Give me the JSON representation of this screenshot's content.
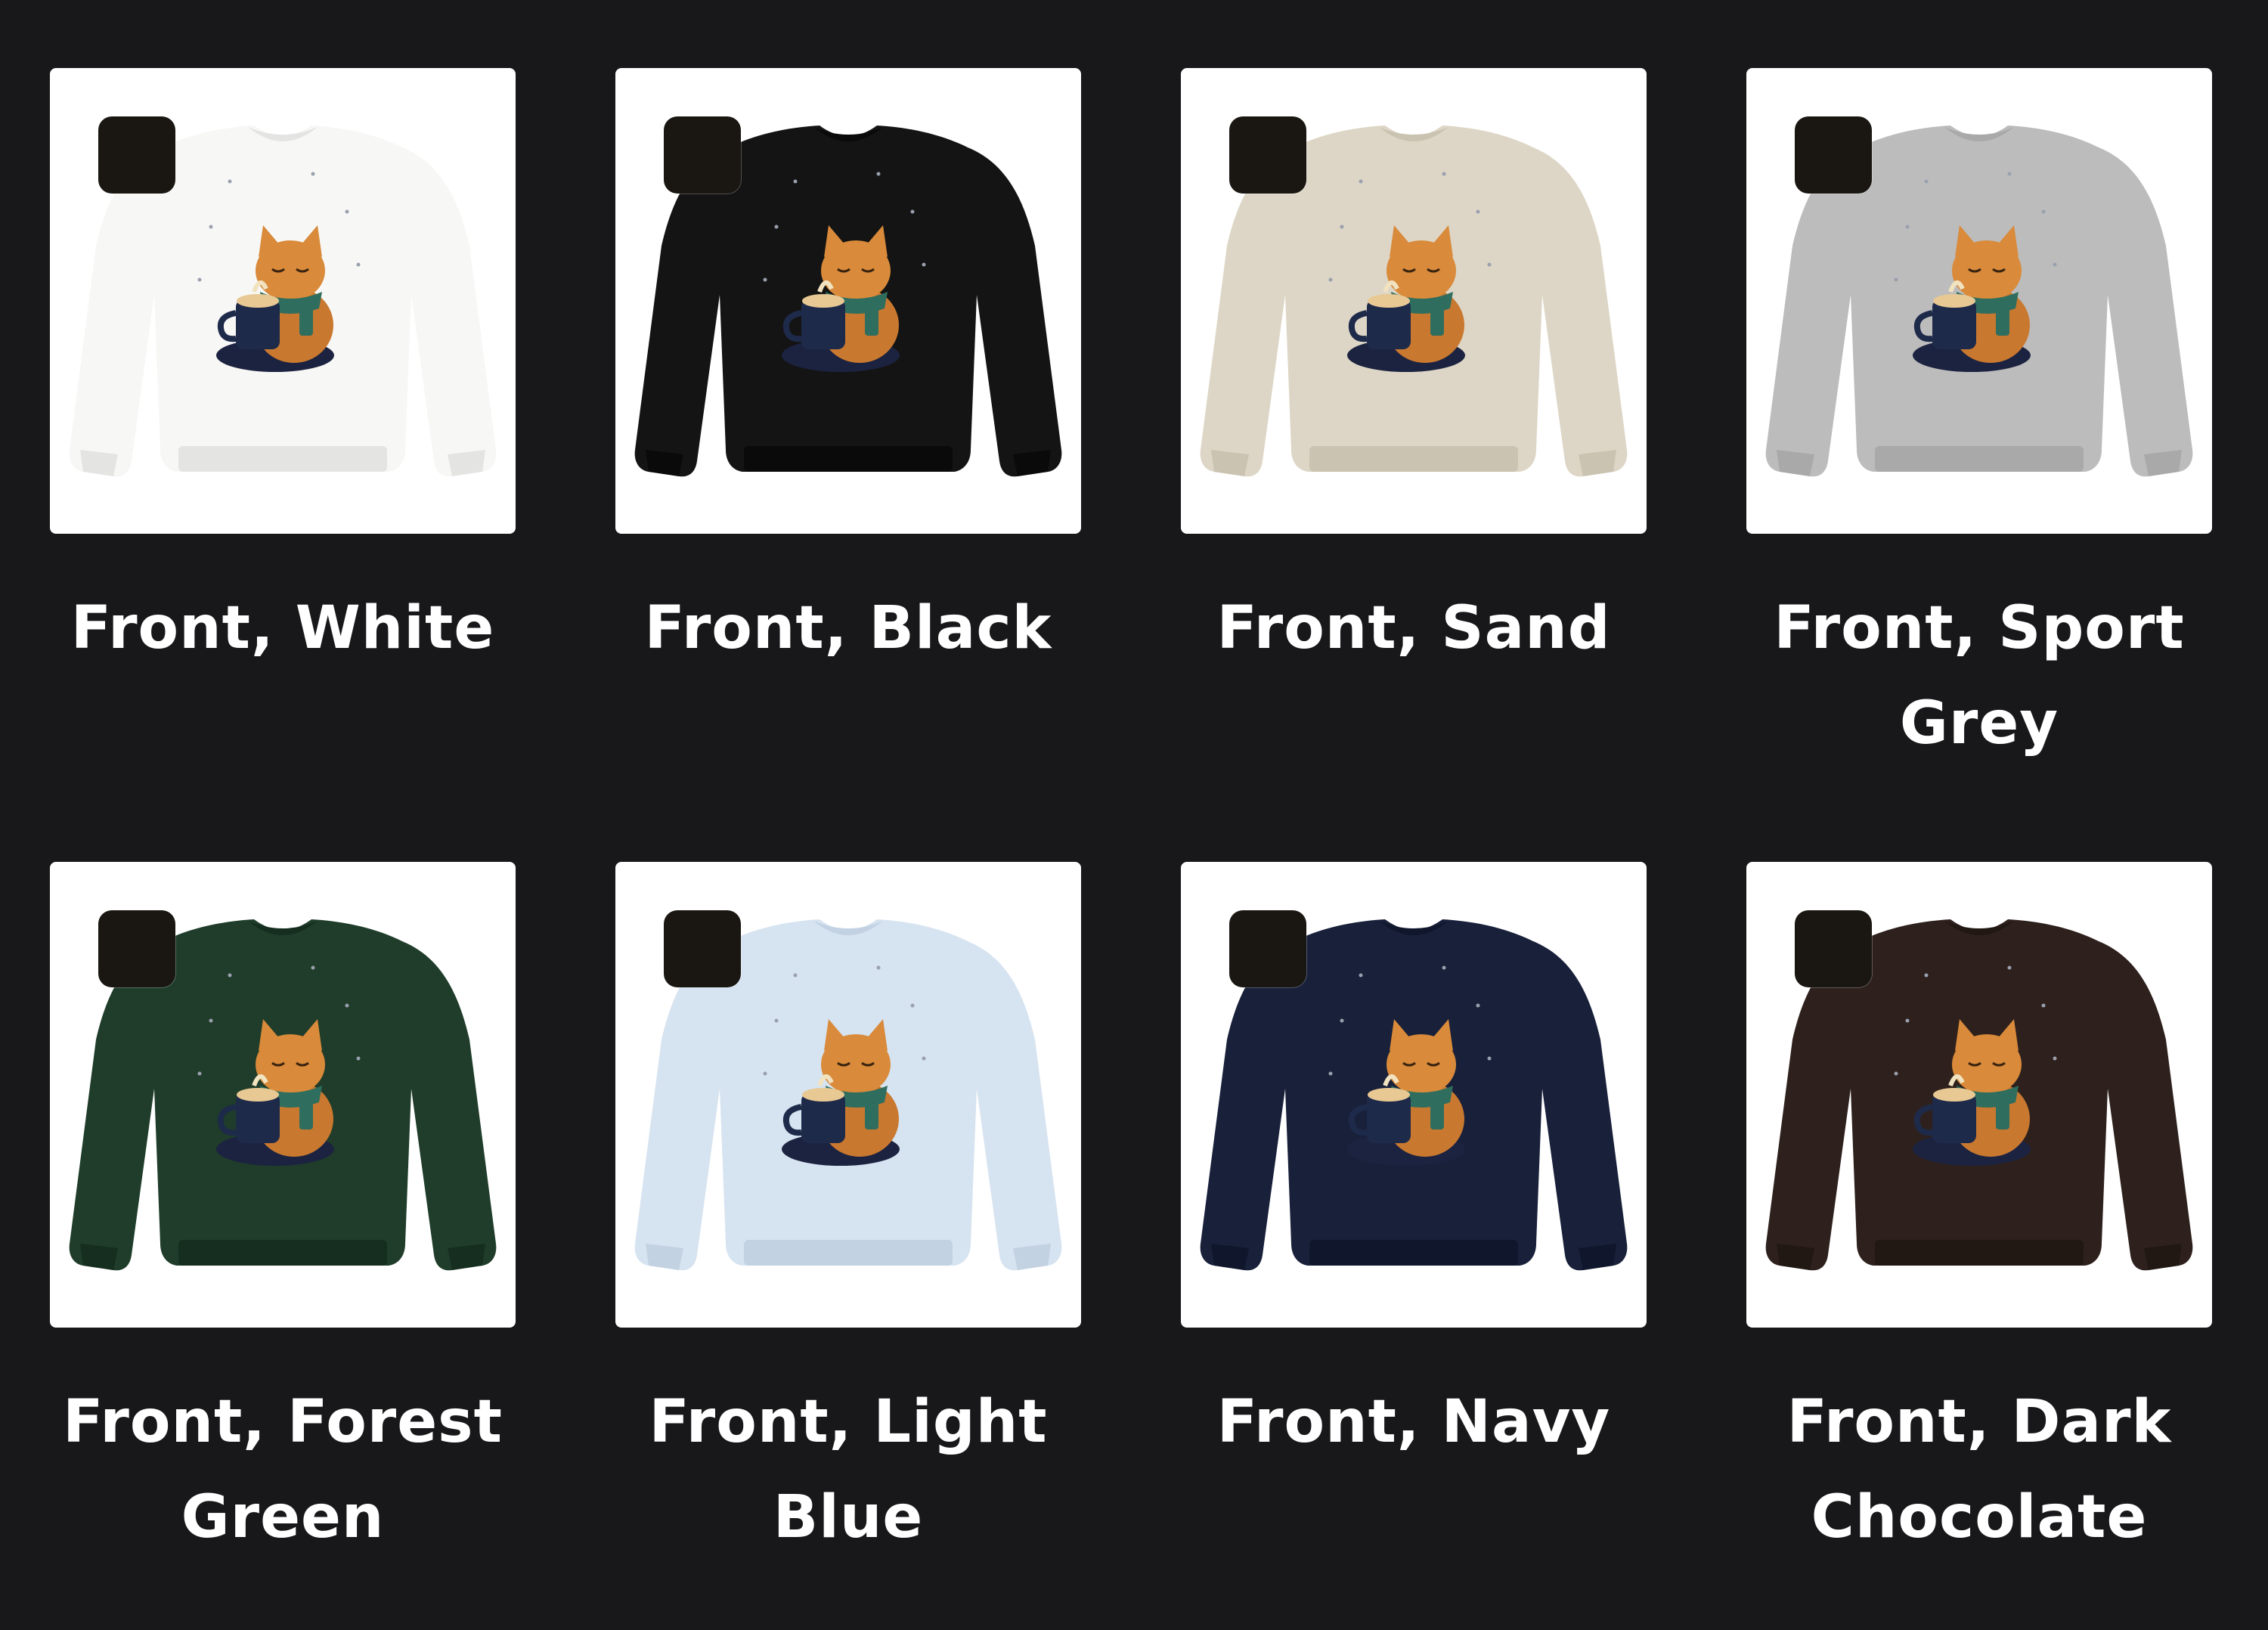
{
  "variants": [
    {
      "label": "Front, White",
      "color": "#f7f7f5",
      "swatch": "#1a1712",
      "shade": "#e4e4e2"
    },
    {
      "label": "Front, Black",
      "color": "#141414",
      "swatch": "#1a1712",
      "shade": "#0a0a0a"
    },
    {
      "label": "Front, Sand",
      "color": "#ddd6c6",
      "swatch": "#1a1712",
      "shade": "#cbc3b1"
    },
    {
      "label": "Front, Sport Grey",
      "color": "#bcbcbc",
      "swatch": "#1a1712",
      "shade": "#a9a9a9"
    },
    {
      "label": "Front, Forest Green",
      "color": "#1f3d2a",
      "swatch": "#1a1712",
      "shade": "#152e1f"
    },
    {
      "label": "Front, Light Blue",
      "color": "#d6e3f0",
      "swatch": "#1a1712",
      "shade": "#c2d2e2"
    },
    {
      "label": "Front, Navy",
      "color": "#18203a",
      "swatch": "#1a1712",
      "shade": "#10172c"
    },
    {
      "label": "Front, Dark Chocolate",
      "color": "#2e211d",
      "swatch": "#1a1712",
      "shade": "#211713"
    }
  ],
  "icons": {
    "design": "cat-with-mug-icon",
    "swatch": "color-swatch-icon"
  }
}
